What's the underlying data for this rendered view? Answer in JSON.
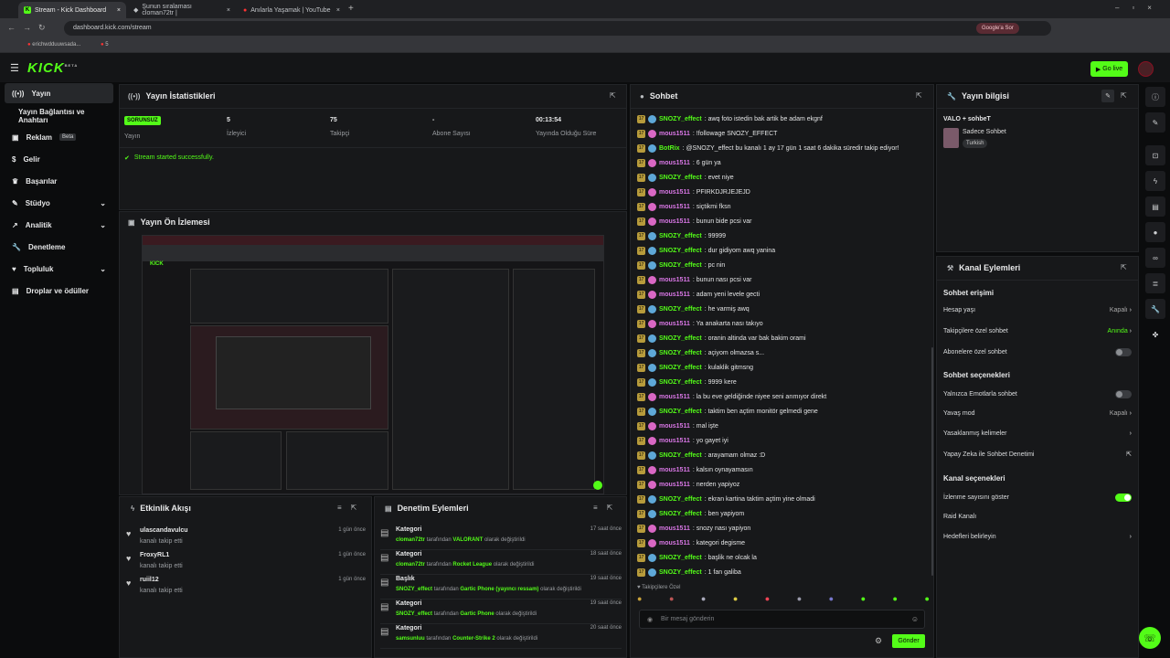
{
  "browser": {
    "tabs": [
      "Stream - Kick Dashboard",
      "Şunun sıralaması cloman72tr |",
      "Anılarla Yaşamak | YouTube"
    ],
    "url": "dashboard.kick.com/stream",
    "google": "Google'a Sor",
    "bookmarks": [
      "erichwdduuwsada...",
      "5"
    ]
  },
  "header": {
    "logo": "KICK",
    "beta": "BETA",
    "golive": "Go live"
  },
  "sidebar": {
    "items": [
      "Yayın",
      "Yayın Bağlantısı ve Anahtarı",
      "Reklam",
      "Gelir",
      "Başarılar",
      "Stüdyo",
      "Analitik",
      "Denetleme",
      "Topluluk",
      "Droplar ve ödüller"
    ],
    "beta": "Beta"
  },
  "stats": {
    "title": "Yayın İstatistikleri",
    "status": "SORUNSUZ",
    "status_label": "Yayın",
    "viewers": "5",
    "viewers_label": "İzleyici",
    "followers": "75",
    "followers_label": "Takipçi",
    "subs": "-",
    "subs_label": "Abone Sayısı",
    "time": "00:13:54",
    "time_label": "Yayında Olduğu Süre",
    "message": "Stream started successfully."
  },
  "preview": {
    "title": "Yayın Ön İzlemesi"
  },
  "activity": {
    "title": "Etkinlik Akışı",
    "items": [
      {
        "user": "ulascandavulcu",
        "action": "kanalı takip etti",
        "time": "1 gün önce"
      },
      {
        "user": "FroxyRL1",
        "action": "kanalı takip etti",
        "time": "1 gün önce"
      },
      {
        "user": "ruiil12",
        "action": "kanalı takip etti",
        "time": "1 gün önce"
      }
    ]
  },
  "moderation": {
    "title": "Denetim Eylemleri",
    "items": [
      {
        "type": "Kategori",
        "who": "cloman72tr",
        "mid": "tarafından",
        "val": "VALORANT",
        "end": "olarak değiştirildi",
        "time": "17 saat önce"
      },
      {
        "type": "Kategori",
        "who": "cloman72tr",
        "mid": "tarafından",
        "val": "Rocket League",
        "end": "olarak değiştirildi",
        "time": "18 saat önce"
      },
      {
        "type": "Başlık",
        "who": "SNOZY_effect",
        "mid": "tarafından",
        "val": "Gartic Phone (yayıncı ressam)",
        "end": "olarak değiştirildi",
        "time": "19 saat önce"
      },
      {
        "type": "Kategori",
        "who": "SNOZY_effect",
        "mid": "tarafından",
        "val": "Gartic Phone",
        "end": "olarak değiştirildi",
        "time": "19 saat önce"
      },
      {
        "type": "Kategori",
        "who": "samsunluu",
        "mid": "tarafından",
        "val": "Counter-Strike 2",
        "end": "olarak değiştirildi",
        "time": "20 saat önce"
      }
    ]
  },
  "chat": {
    "title": "Sohbet",
    "messages": [
      {
        "u": "SNOZY_effect",
        "c": "g",
        "b": "s",
        "t": ": awq foto istedin bak artik be adam ekgnf"
      },
      {
        "u": "mous1511",
        "c": "m",
        "b": "p",
        "t": ": !followage SNOZY_EFFECT"
      },
      {
        "u": "BotRix",
        "c": "g",
        "b": "s",
        "t": ": @SNOZY_effect bu kanalı 1 ay 17 gün 1 saat 6 dakika süredir takip ediyor!"
      },
      {
        "u": "mous1511",
        "c": "m",
        "b": "p",
        "t": ": 6 gün ya"
      },
      {
        "u": "SNOZY_effect",
        "c": "g",
        "b": "s",
        "t": ": evet niye"
      },
      {
        "u": "mous1511",
        "c": "m",
        "b": "p",
        "t": ": PFIRKDJRJEJEJD"
      },
      {
        "u": "mous1511",
        "c": "m",
        "b": "p",
        "t": ": siçtikmi fksn"
      },
      {
        "u": "mous1511",
        "c": "m",
        "b": "p",
        "t": ": bunun bide pcsi var"
      },
      {
        "u": "SNOZY_effect",
        "c": "g",
        "b": "s",
        "t": ": 99999"
      },
      {
        "u": "SNOZY_effect",
        "c": "g",
        "b": "s",
        "t": ": dur gidiyom awq yanina"
      },
      {
        "u": "SNOZY_effect",
        "c": "g",
        "b": "s",
        "t": ": pc nin"
      },
      {
        "u": "mous1511",
        "c": "m",
        "b": "p",
        "t": ": bunun nası pcsi var"
      },
      {
        "u": "mous1511",
        "c": "m",
        "b": "p",
        "t": ": adam yeni levele gecti"
      },
      {
        "u": "SNOZY_effect",
        "c": "g",
        "b": "s",
        "t": ": he varmiş awq"
      },
      {
        "u": "mous1511",
        "c": "m",
        "b": "p",
        "t": ": Ya anakarta nası takıyo"
      },
      {
        "u": "SNOZY_effect",
        "c": "g",
        "b": "s",
        "t": ": oranin altinda var bak bakim orami"
      },
      {
        "u": "SNOZY_effect",
        "c": "g",
        "b": "s",
        "t": ": açiyom olmazsa s..."
      },
      {
        "u": "SNOZY_effect",
        "c": "g",
        "b": "s",
        "t": ": kulaklik gitmsng"
      },
      {
        "u": "SNOZY_effect",
        "c": "g",
        "b": "s",
        "t": ": 9999 kere"
      },
      {
        "u": "mous1511",
        "c": "m",
        "b": "p",
        "t": ": la bu eve geldiğinde niyee seni arımıyor direkt"
      },
      {
        "u": "SNOZY_effect",
        "c": "g",
        "b": "s",
        "t": ": taktim ben açtim monitör gelmedi gene"
      },
      {
        "u": "mous1511",
        "c": "m",
        "b": "p",
        "t": ": mal işte"
      },
      {
        "u": "mous1511",
        "c": "m",
        "b": "p",
        "t": ": yo gayet iyi"
      },
      {
        "u": "SNOZY_effect",
        "c": "g",
        "b": "s",
        "t": ": arayamam olmaz :D"
      },
      {
        "u": "mous1511",
        "c": "m",
        "b": "p",
        "t": ": kalsın oynayamasın"
      },
      {
        "u": "mous1511",
        "c": "m",
        "b": "p",
        "t": ": nerden yapiyoz"
      },
      {
        "u": "SNOZY_effect",
        "c": "g",
        "b": "s",
        "t": ": ekran kartina taktim açtim yine olmadi"
      },
      {
        "u": "SNOZY_effect",
        "c": "g",
        "b": "s",
        "t": ": ben yapiyom"
      },
      {
        "u": "mous1511",
        "c": "m",
        "b": "p",
        "t": ": snozy nası yapiyon"
      },
      {
        "u": "mous1511",
        "c": "m",
        "b": "p",
        "t": ": kategori degisme"
      },
      {
        "u": "SNOZY_effect",
        "c": "g",
        "b": "s",
        "t": ": başlik ne olcak la"
      },
      {
        "u": "SNOZY_effect",
        "c": "g",
        "b": "s",
        "t": ": 1 fan galiba"
      }
    ],
    "followers_only": "Takipçilere Özel",
    "placeholder": "Bir mesaj gönderin",
    "send": "Gönder"
  },
  "info": {
    "title": "Yayın bilgisi",
    "stream_title": "VALO + sohbeT",
    "category": "Sadece Sohbet",
    "tag": "Turkish"
  },
  "actions": {
    "title": "Kanal Eylemleri",
    "sec1": "Sohbet erişimi",
    "r1": "Hesap yaşı",
    "r1v": "Kapalı",
    "r2": "Takipçilere özel sohbet",
    "r2v": "Anında",
    "r3": "Abonelere özel sohbet",
    "sec2": "Sohbet seçenekleri",
    "r4": "Yalnızca Emotlarla sohbet",
    "r5": "Yavaş mod",
    "r5v": "Kapalı",
    "r6": "Yasaklanmış kelimeler",
    "r7": "Yapay Zeka ile Sohbet Denetimi",
    "sec3": "Kanal seçenekleri",
    "r8": "İzlenme sayısını göster",
    "r9": "Raid Kanalı",
    "r10": "Hedefleri belirleyin"
  }
}
